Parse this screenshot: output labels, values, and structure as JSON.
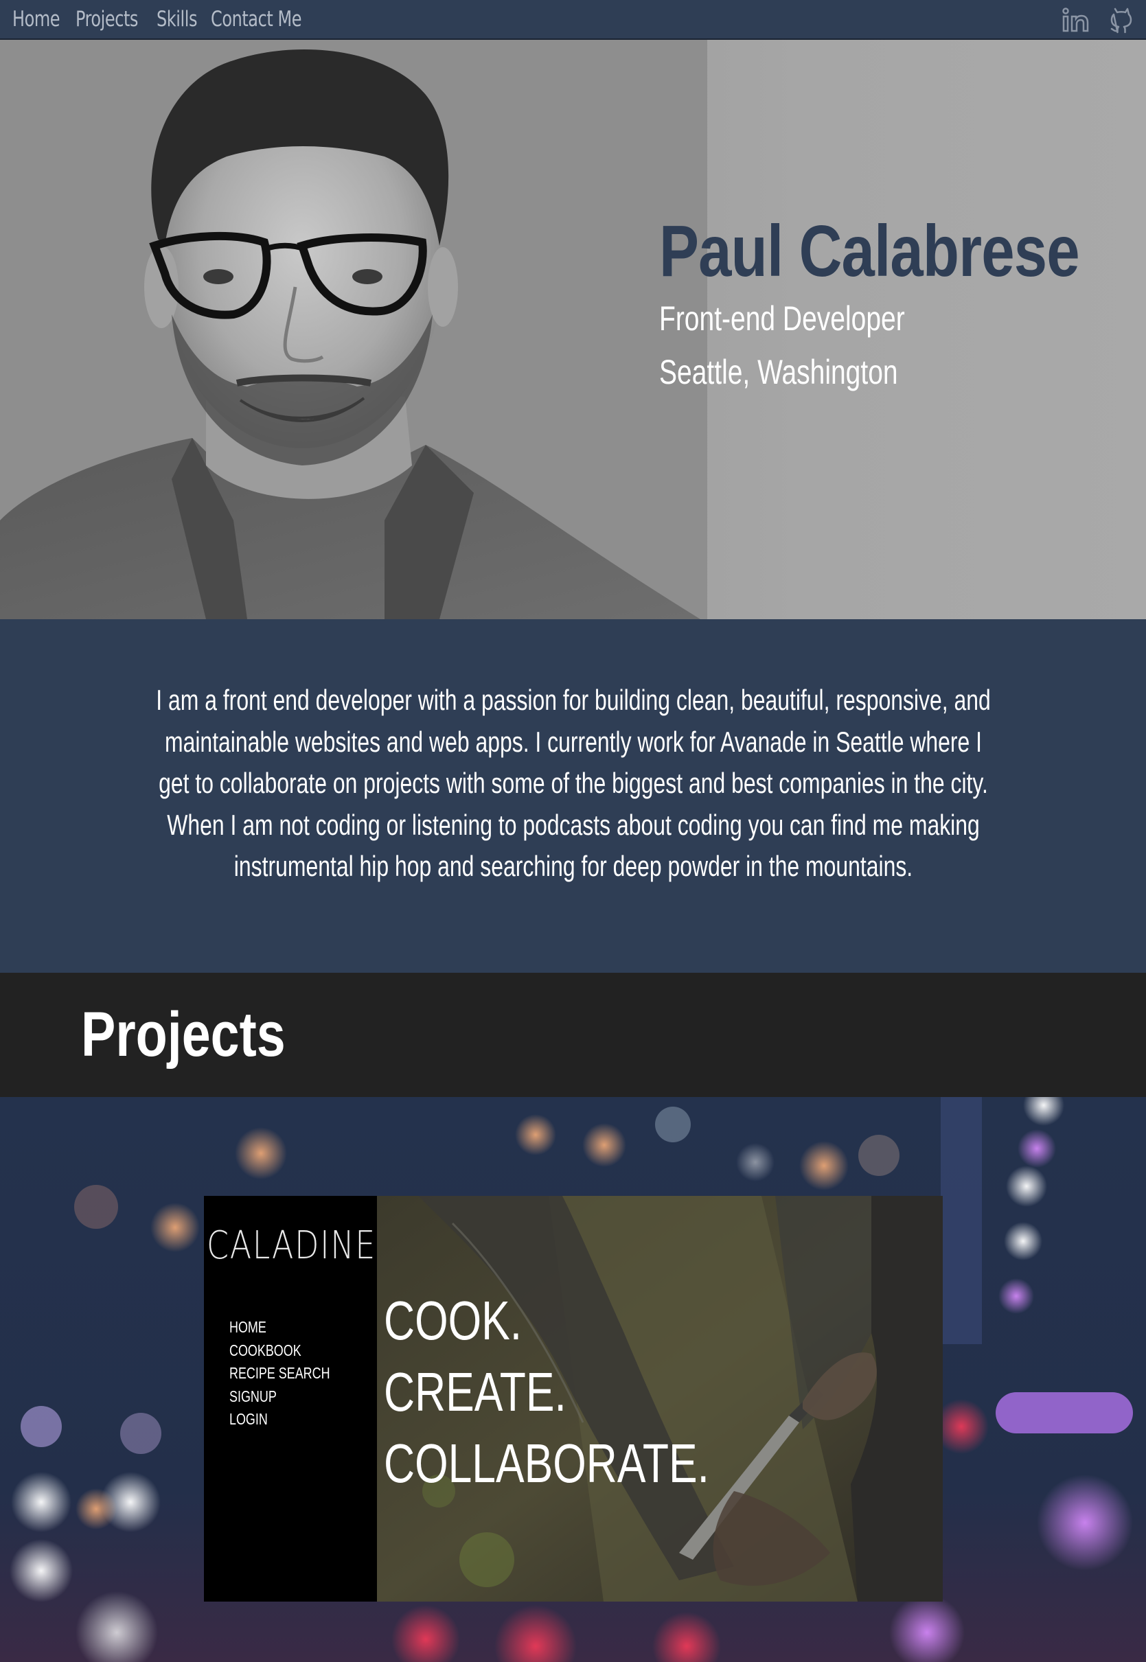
{
  "nav": {
    "links": [
      "Home",
      "Projects",
      "Skills",
      "Contact Me"
    ],
    "icons": [
      "linkedin-icon",
      "github-icon"
    ]
  },
  "hero": {
    "name": "Paul Calabrese",
    "title": "Front-end Developer",
    "location": "Seattle, Washington"
  },
  "about": {
    "text": "I am a front end developer with a passion for building clean, beautiful, responsive, and maintainable websites and web apps. I currently work for Avanade in Seattle where I get to collaborate on projects with some of the biggest and best companies in the city. When I am not coding or listening to podcasts about coding you can find me making instrumental hip hop and searching for deep powder in the mountains."
  },
  "projects": {
    "heading": "Projects",
    "featured": {
      "logo": "CALADINE",
      "menu": [
        "HOME",
        "COOKBOOK",
        "RECIPE SEARCH",
        "SIGNUP",
        "LOGIN"
      ],
      "tagline": [
        "COOK.",
        "CREATE.",
        "COLLABORATE."
      ]
    }
  },
  "colors": {
    "navy": "#2f3e55",
    "dark": "#222222",
    "hero_gray": "#a6a6a6"
  }
}
